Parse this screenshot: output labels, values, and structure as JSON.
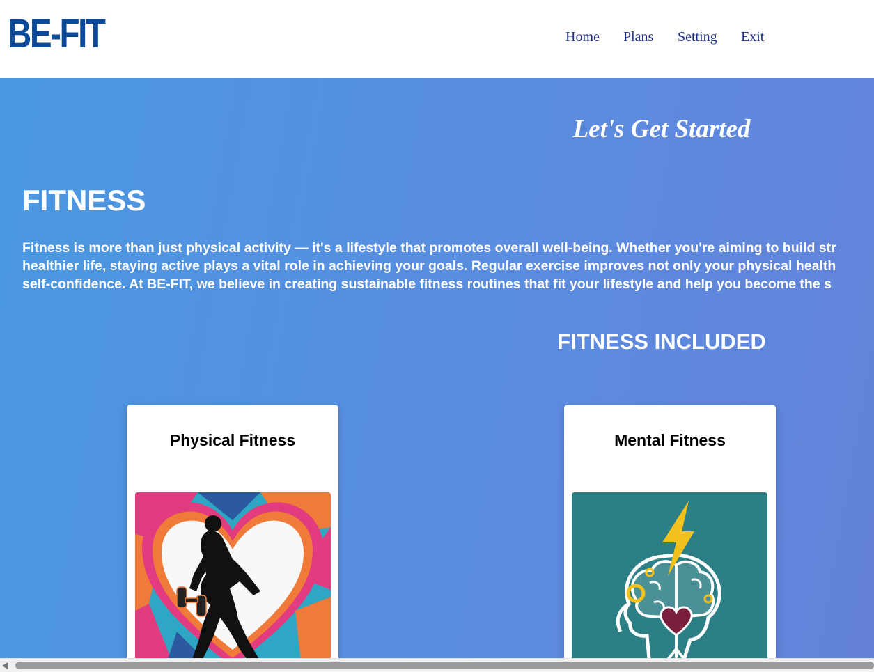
{
  "header": {
    "logo": "BE-FIT",
    "nav": {
      "home": "Home",
      "plans": "Plans",
      "setting": "Setting",
      "exit": "Exit"
    }
  },
  "hero": {
    "tagline": "Let's Get Started",
    "title": "FITNESS",
    "description_lines": [
      "Fitness is more than just physical activity — it's a lifestyle that promotes overall well-being. Whether you're aiming to build str",
      "healthier life, staying active plays a vital role in achieving your goals. Regular exercise improves not only your physical health",
      "self-confidence. At BE-FIT, we believe in creating sustainable fitness routines that fit your lifestyle and help you become the s"
    ],
    "section_title": "FITNESS INCLUDED"
  },
  "cards": [
    {
      "title": "Physical Fitness",
      "image_icon": "muscular-man-dumbbell-heart-icon"
    },
    {
      "title": "Mental Fitness",
      "image_icon": "brain-lightning-heart-icon"
    }
  ],
  "colors": {
    "logo": "#0c4a99",
    "nav": "#1f2f8f",
    "hero_start": "#4a98e0",
    "hero_end": "#6482d8"
  }
}
